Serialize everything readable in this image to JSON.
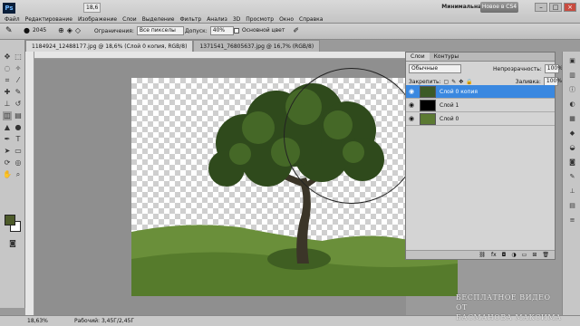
{
  "app": {
    "logo": "Ps",
    "workspace": "Минимальная",
    "new_cs4": "Новое в CS4"
  },
  "menu": [
    "Файл",
    "Редактирование",
    "Изображение",
    "Слои",
    "Выделение",
    "Фильтр",
    "Анализ",
    "3D",
    "Просмотр",
    "Окно",
    "Справка"
  ],
  "top_tools": {
    "zoom": "18,6",
    "brush_size": "2045"
  },
  "options": {
    "limit_label": "Ограничения:",
    "limit_value": "Все пикселы",
    "tolerance_label": "Допуск:",
    "tolerance_value": "40%",
    "main_color_label": "Основной цвет"
  },
  "tabs": [
    {
      "label": "1184924_12488177.jpg @ 18,6% (Слой 0 копия, RGB/8)",
      "active": true
    },
    {
      "label": "1371541_76805637.jpg @ 16,7% (RGB/8)",
      "active": false
    }
  ],
  "layers_panel": {
    "tabs": [
      "Слои",
      "Контуры"
    ],
    "blend_mode": "Обычные",
    "opacity_label": "Непрозрачность:",
    "opacity_value": "100%",
    "lock_label": "Закрепить:",
    "fill_label": "Заливка:",
    "fill_value": "100%",
    "layers": [
      {
        "name": "Слой 0 копия",
        "selected": true
      },
      {
        "name": "Слой 1",
        "selected": false
      },
      {
        "name": "Слой 0",
        "selected": false
      }
    ],
    "footer_icons": [
      "fx"
    ]
  },
  "status": {
    "zoom": "18,63%",
    "doc": "Рабочий: 3,45Г/2,45Г"
  },
  "watermark": {
    "line1": "БЕСПЛАТНОЕ ВИДЕО ОТ",
    "line2": "БАСМАНОВА МАКСИМА"
  },
  "colors": {
    "foreground": "#4d5b2a",
    "background": "#ffffff",
    "selection": "#3a88e0"
  }
}
